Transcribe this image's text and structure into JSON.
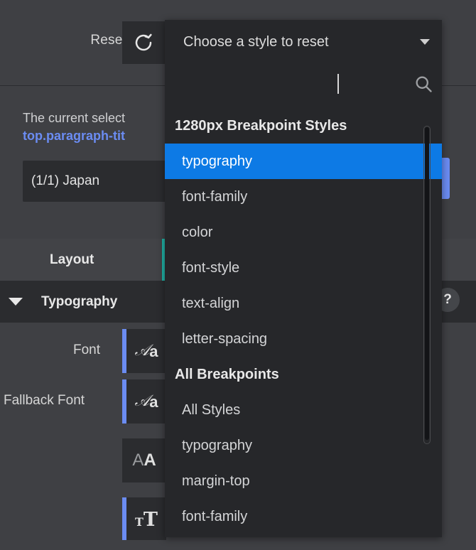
{
  "style_panel": {
    "reset": {
      "label": "Reset",
      "icon": "refresh-icon"
    },
    "selector_info": {
      "description": "The current select",
      "selector_name": "top.paragraph-tit",
      "instance_field_value": "(1/1) Japan"
    },
    "sections": [
      {
        "name": "Layout",
        "expanded": false,
        "accent_color": "#20b2a6"
      },
      {
        "name": "Typography",
        "expanded": true,
        "caret": "chevron-down-icon"
      }
    ],
    "help_badge": "?",
    "typography_controls": [
      {
        "label": "Font",
        "icon": "font-italic-serif-icon",
        "accent": true
      },
      {
        "label": "Fallback Font",
        "icon": "font-italic-serif-icon",
        "accent": true
      },
      {
        "label": "",
        "icon": "font-size-icon",
        "accent": false
      },
      {
        "label": "",
        "icon": "font-weight-icon",
        "accent": true
      }
    ]
  },
  "dropdown": {
    "title": "Choose a style to reset",
    "caret_icon": "chevron-down-icon",
    "search": {
      "value": "",
      "placeholder": "",
      "icon": "search-icon"
    },
    "groups": [
      {
        "label": "1280px Breakpoint Styles",
        "items": [
          {
            "label": "typography",
            "selected": true
          },
          {
            "label": "font-family",
            "selected": false
          },
          {
            "label": "color",
            "selected": false
          },
          {
            "label": "font-style",
            "selected": false
          },
          {
            "label": "text-align",
            "selected": false
          },
          {
            "label": "letter-spacing",
            "selected": false
          }
        ]
      },
      {
        "label": "All Breakpoints",
        "items": [
          {
            "label": "All Styles",
            "selected": false
          },
          {
            "label": "typography",
            "selected": false
          },
          {
            "label": "margin-top",
            "selected": false
          },
          {
            "label": "font-family",
            "selected": false
          }
        ]
      }
    ],
    "colors": {
      "selected_bg": "#0d7ae5",
      "panel_bg": "#26272a"
    }
  }
}
